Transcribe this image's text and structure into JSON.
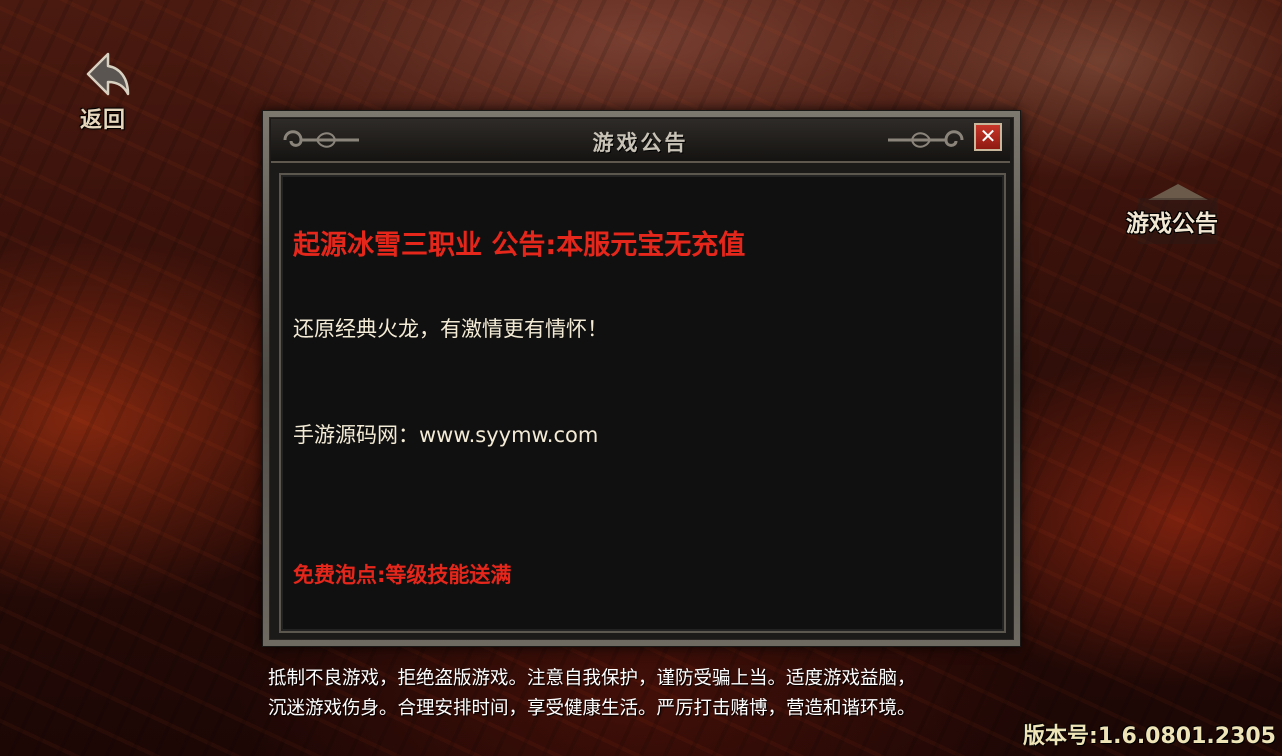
{
  "back_button": {
    "label": "返回",
    "icon": "back-arrow-icon"
  },
  "side_notice_button": {
    "label": "游戏公告"
  },
  "dialog": {
    "title": "游戏公告",
    "close_glyph": "✕",
    "announcement": {
      "headline": "起源冰雪三职业 公告:本服元宝无充值",
      "line1": "还原经典火龙，有激情更有情怀！",
      "line2": "手游源码网：www.syymw.com",
      "line3": "免费泡点:等级技能送满"
    }
  },
  "footer": {
    "warning_line1": "抵制不良游戏，拒绝盗版游戏。注意自我保护，谨防受骗上当。适度游戏益脑，",
    "warning_line2": "沉迷游戏伤身。合理安排时间，享受健康生活。严厉打击赌博，营造和谐环境。",
    "version": "版本号:1.6.0801.2305"
  },
  "colors": {
    "headline_red": "#e5261b",
    "body_text": "#f3ebd6",
    "version_text": "#efe4b8"
  }
}
